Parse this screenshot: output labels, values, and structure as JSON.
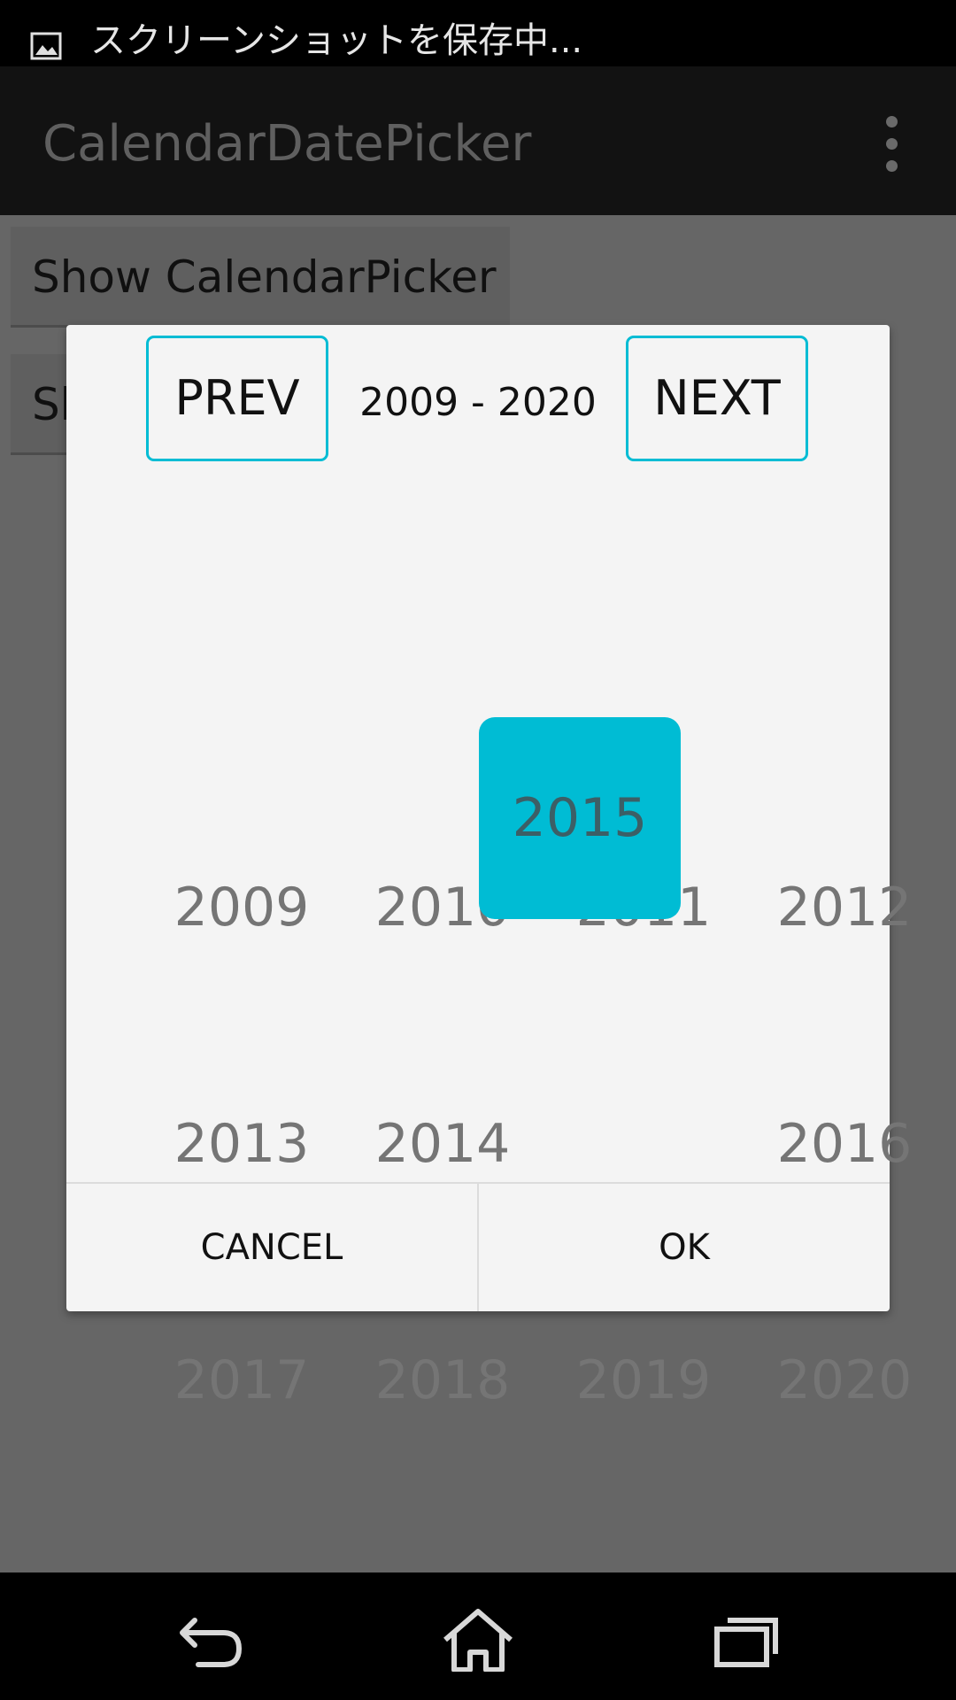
{
  "status_bar": {
    "notification_text": "スクリーンショットを保存中...",
    "notification_icon": "image-icon"
  },
  "action_bar": {
    "title": "CalendarDatePicker",
    "menu_icon": "overflow-menu-icon"
  },
  "background": {
    "buttons": [
      {
        "label": "Show CalendarPicker"
      },
      {
        "label": "Sh"
      }
    ]
  },
  "dialog": {
    "prev_label": "PREV",
    "next_label": "NEXT",
    "range_label": "2009 - 2020",
    "years": [
      "2009",
      "2010",
      "2011",
      "2012",
      "2013",
      "2014",
      "2015",
      "2016",
      "2017",
      "2018",
      "2019",
      "2020"
    ],
    "selected_year": "2015",
    "cancel_label": "CANCEL",
    "ok_label": "OK",
    "accent_color": "#00bcd4"
  },
  "nav_bar": {
    "icons": [
      "back-icon",
      "home-icon",
      "recents-icon"
    ]
  }
}
